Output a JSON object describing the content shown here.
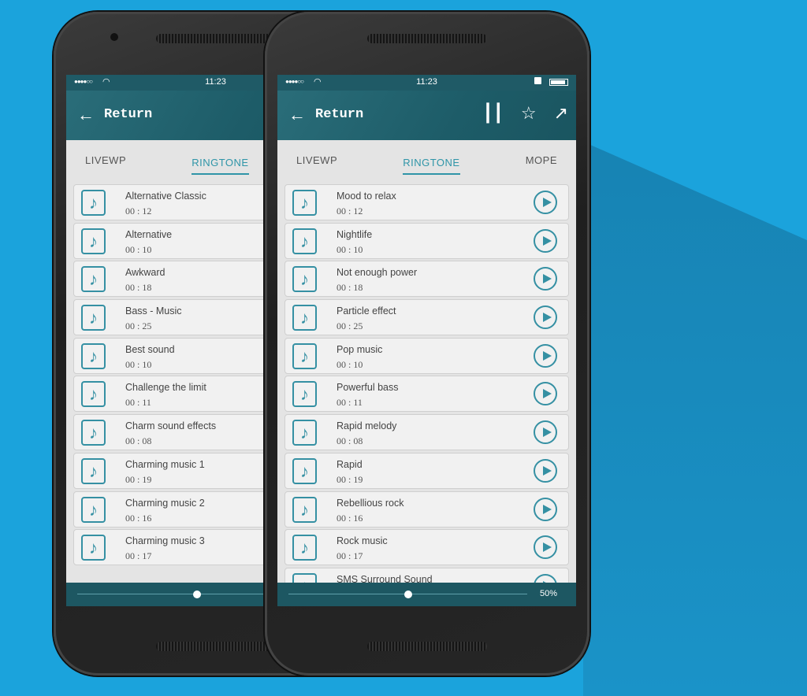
{
  "colors": {
    "background": "#1ba3dc",
    "header": "#1d5c68",
    "accent": "#2f95a8"
  },
  "status": {
    "time": "11:23",
    "signal": "●●●●○○"
  },
  "header": {
    "back_label": "Return"
  },
  "tabs": [
    {
      "label": "LIVEWP"
    },
    {
      "label": "RINGTONE",
      "active": true
    },
    {
      "label": "MOPE"
    }
  ],
  "back_phone": {
    "items": [
      {
        "name": "Alternative Classic",
        "duration": "00 : 12"
      },
      {
        "name": "Alternative",
        "duration": "00 : 10"
      },
      {
        "name": "Awkward",
        "duration": "00 : 18"
      },
      {
        "name": "Bass - Music",
        "duration": "00 : 25"
      },
      {
        "name": "Best sound",
        "duration": "00 : 10"
      },
      {
        "name": "Challenge the limit",
        "duration": "00 : 11"
      },
      {
        "name": "Charm sound effects",
        "duration": "00 : 08"
      },
      {
        "name": "Charming music 1",
        "duration": "00 : 19"
      },
      {
        "name": "Charming music 2",
        "duration": "00 : 16"
      },
      {
        "name": "Charming music 3",
        "duration": "00 : 17"
      }
    ]
  },
  "front_phone": {
    "items": [
      {
        "name": "Mood to relax",
        "duration": "00 : 12"
      },
      {
        "name": "Nightlife",
        "duration": "00 : 10"
      },
      {
        "name": "Not enough power",
        "duration": "00 : 18"
      },
      {
        "name": "Particle effect",
        "duration": "00 : 25"
      },
      {
        "name": "Pop music",
        "duration": "00 : 10"
      },
      {
        "name": "Powerful bass",
        "duration": "00 : 11"
      },
      {
        "name": "Rapid melody",
        "duration": "00 : 08"
      },
      {
        "name": "Rapid",
        "duration": "00 : 19"
      },
      {
        "name": "Rebellious rock",
        "duration": "00 : 16"
      },
      {
        "name": "Rock music",
        "duration": "00 : 17"
      },
      {
        "name": "SMS Surround Sound",
        "duration": ""
      }
    ]
  },
  "volume": {
    "percent": 50,
    "label": "50%"
  }
}
